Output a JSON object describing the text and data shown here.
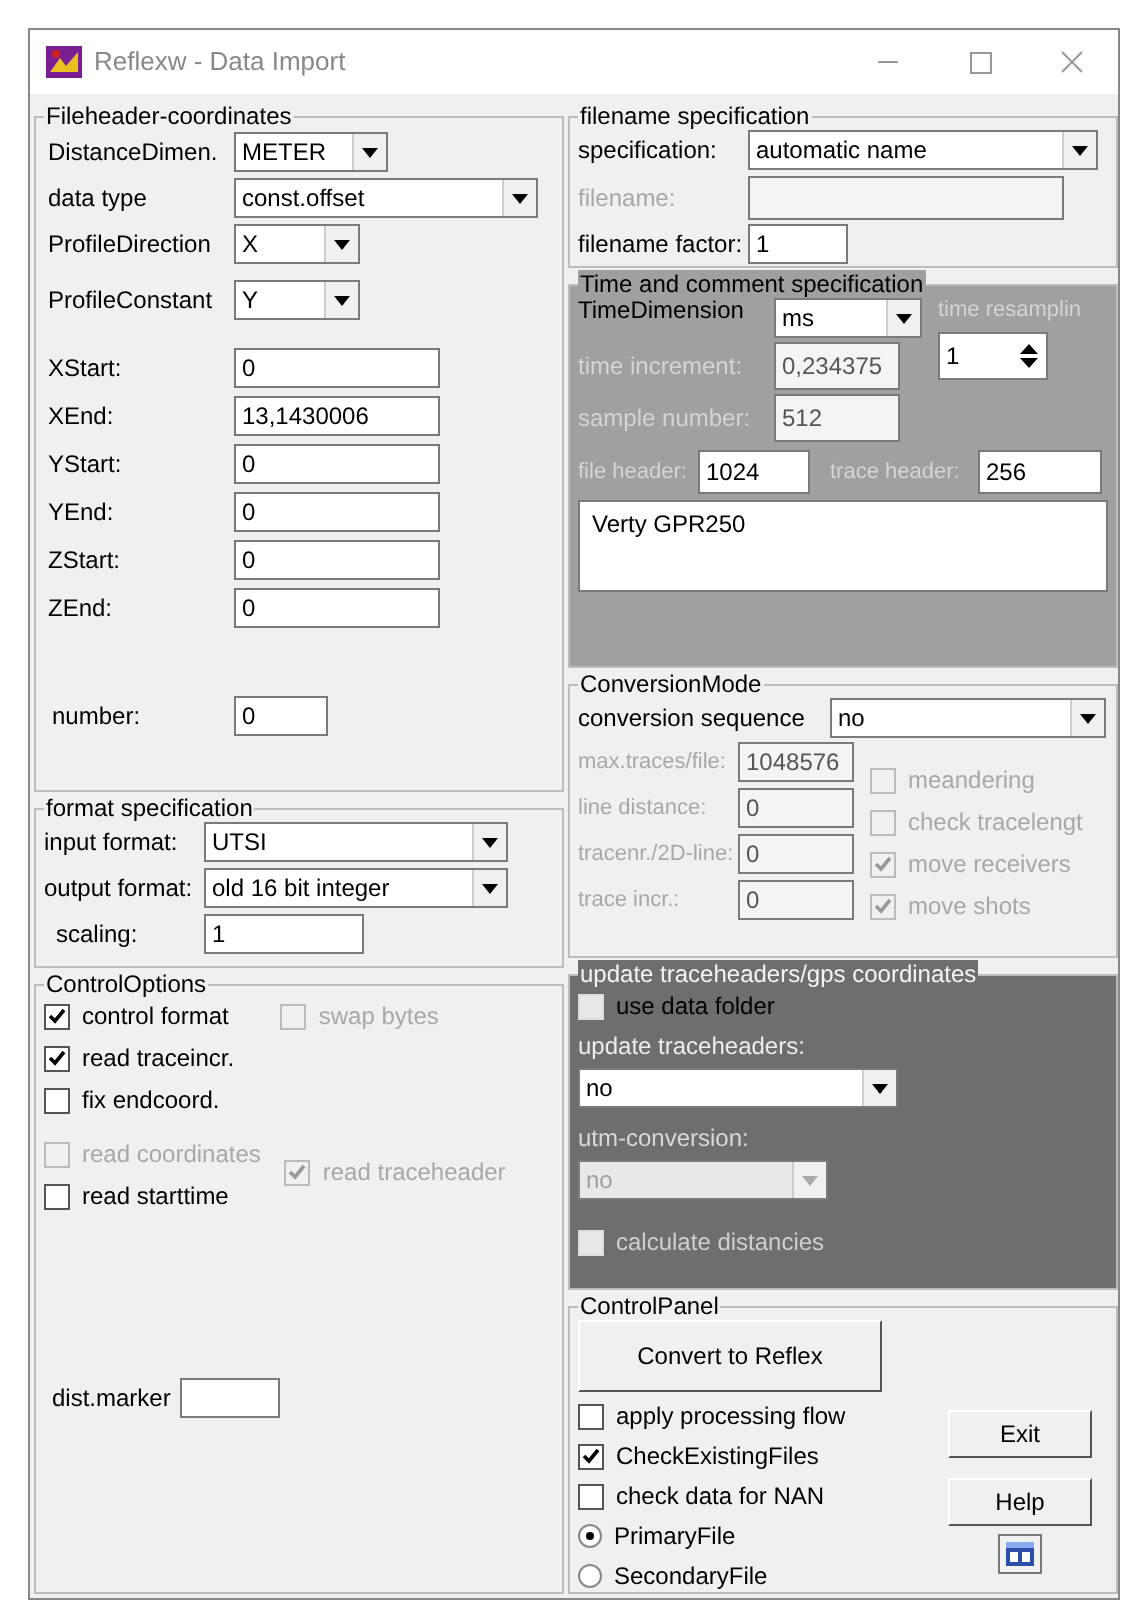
{
  "window": {
    "title": "Reflexw - Data Import"
  },
  "fileheader": {
    "title": "Fileheader-coordinates",
    "selects": [
      {
        "label": "DistanceDimen.",
        "value": "METER"
      },
      {
        "label": "data type",
        "value": "const.offset"
      },
      {
        "label": "ProfileDirection",
        "value": "X"
      },
      {
        "label": "ProfileConstant",
        "value": "Y"
      }
    ],
    "coordinates": [
      {
        "label": "XStart:",
        "value": "0"
      },
      {
        "label": "XEnd:",
        "value": "13,1430006"
      },
      {
        "label": "YStart:",
        "value": "0"
      },
      {
        "label": "YEnd:",
        "value": "0"
      },
      {
        "label": "ZStart:",
        "value": "0"
      },
      {
        "label": "ZEnd:",
        "value": "0"
      }
    ],
    "number": {
      "label": "number:",
      "value": "0"
    }
  },
  "format": {
    "title": "format specification",
    "input_format": {
      "label": "input format:",
      "value": "UTSI"
    },
    "output_format": {
      "label": "output format:",
      "value": "old 16 bit integer"
    },
    "scaling": {
      "label": "scaling:",
      "value": "1"
    }
  },
  "control_options": {
    "title": "ControlOptions",
    "swap_bytes": {
      "label": "swap bytes",
      "checked": false,
      "disabled": true
    },
    "checkboxes": [
      {
        "label": "control format",
        "checked": true,
        "disabled": false
      },
      {
        "label": "read traceincr.",
        "checked": true,
        "disabled": false
      },
      {
        "label": "fix endcoord.",
        "checked": false,
        "disabled": false
      },
      {
        "label": "read coordinates",
        "checked": false,
        "disabled": true
      },
      {
        "label": "read starttime",
        "checked": false,
        "disabled": false
      }
    ],
    "read_traceheader": {
      "label": "read traceheader",
      "checked": true,
      "disabled": true
    },
    "dist_marker": {
      "label": "dist.marker"
    }
  },
  "filename_spec": {
    "title": "filename specification",
    "specification": {
      "label": "specification:",
      "value": "automatic name"
    },
    "filename": {
      "label": "filename:",
      "disabled": true
    },
    "filename_factor": {
      "label": "filename factor:",
      "value": "1"
    }
  },
  "time_comment": {
    "title": "Time and comment specification",
    "time_dimension": {
      "label": "TimeDimension",
      "value": "ms"
    },
    "time_resampling": {
      "label": "time resamplin",
      "value": "1",
      "disabled": true
    },
    "time_increment": {
      "label": "time increment:",
      "value": "0,234375",
      "disabled": true
    },
    "sample_number": {
      "label": "sample number:",
      "value": "512",
      "disabled": true
    },
    "file_header": {
      "label": "file header:",
      "value": "1024",
      "disabled": true
    },
    "trace_header": {
      "label": "trace header:",
      "value": "256",
      "disabled": true
    },
    "comment": "Verty GPR250"
  },
  "conversion": {
    "title": "ConversionMode",
    "sequence": {
      "label": "conversion sequence",
      "value": "no"
    },
    "fields": [
      {
        "label": "max.traces/file:",
        "value": "1048576",
        "disabled": true
      },
      {
        "label": "line distance:",
        "value": "0",
        "disabled": true
      },
      {
        "label": "tracenr./2D-line:",
        "value": "0",
        "disabled": true
      },
      {
        "label": "trace incr.:",
        "value": "0",
        "disabled": true
      }
    ],
    "options": [
      {
        "label": "meandering",
        "checked": false,
        "disabled": true
      },
      {
        "label": "check tracelengt",
        "checked": false,
        "disabled": true
      },
      {
        "label": "move receivers",
        "checked": true,
        "disabled": true
      },
      {
        "label": "move shots",
        "checked": true,
        "disabled": true
      }
    ]
  },
  "update": {
    "title": "update traceheaders/gps coordinates",
    "use_data_folder": {
      "label": "use data folder",
      "checked": false,
      "disabled": false
    },
    "update_traceheaders": {
      "label": "update traceheaders:",
      "value": "no"
    },
    "utm_conversion": {
      "label": "utm-conversion:",
      "value": "no",
      "disabled": true
    },
    "calculate": {
      "label": "calculate distancies",
      "checked": false,
      "disabled": true
    }
  },
  "control_panel": {
    "title": "ControlPanel",
    "convert_button": "Convert to Reflex",
    "exit_button": "Exit",
    "help_button": "Help",
    "options": [
      {
        "label": "apply processing flow",
        "checked": false
      },
      {
        "label": "CheckExistingFiles",
        "checked": true
      },
      {
        "label": "check data for NAN",
        "checked": false
      }
    ],
    "file_type": [
      {
        "label": "PrimaryFile",
        "selected": true
      },
      {
        "label": "SecondaryFile",
        "selected": false
      }
    ]
  }
}
